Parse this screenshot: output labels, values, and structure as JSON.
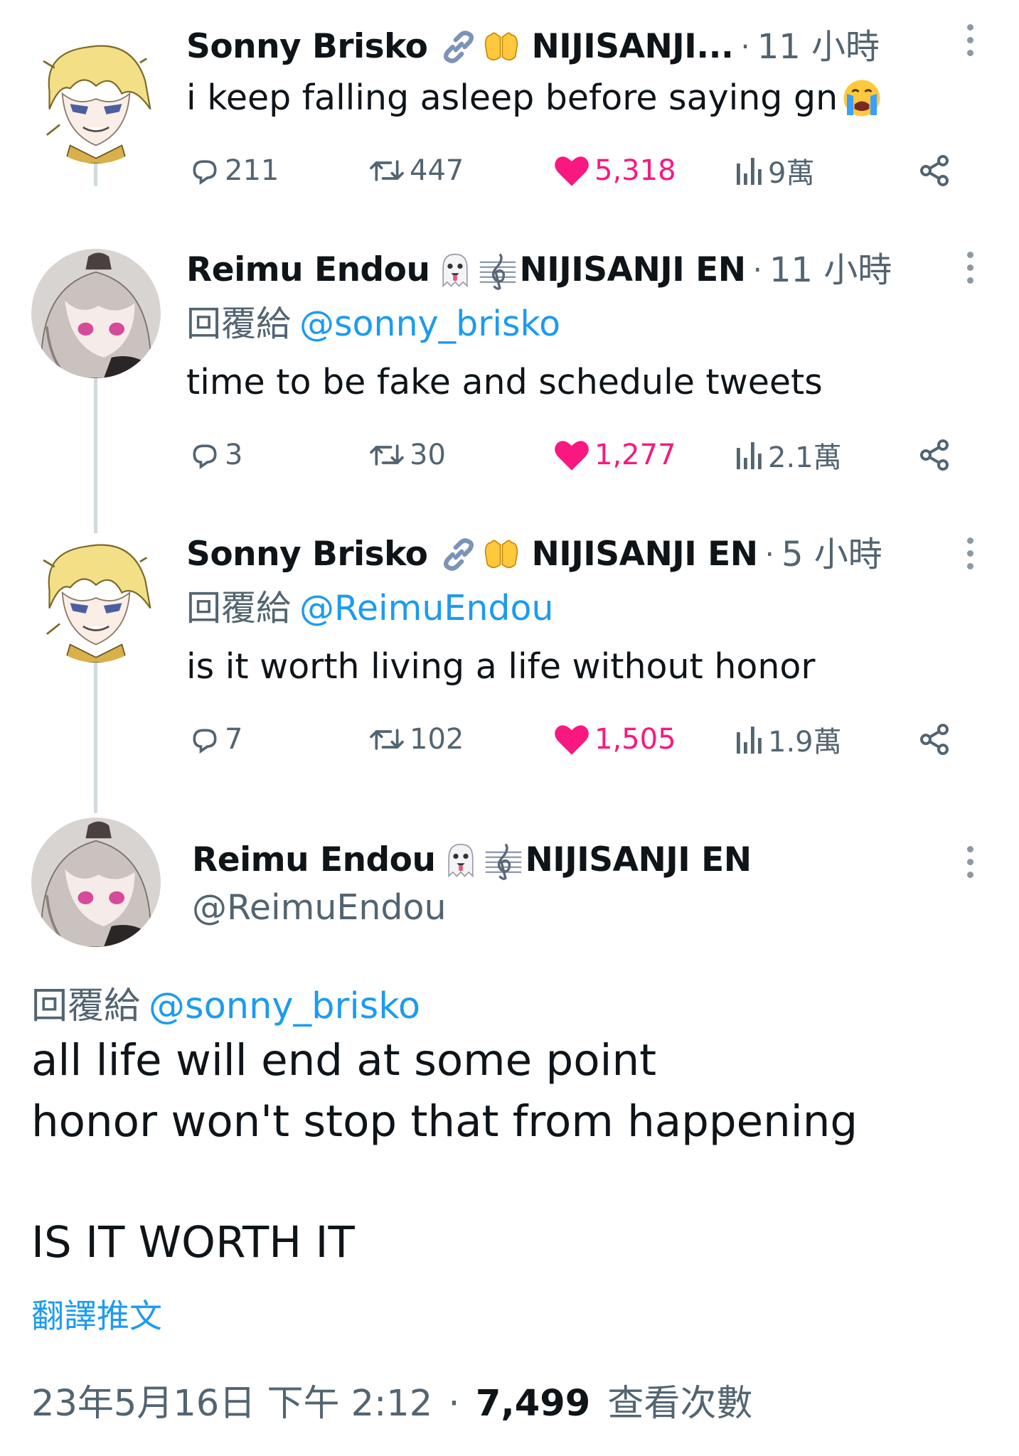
{
  "thread": [
    {
      "author": "Sonny Brisko",
      "badge": "NIJISANJI...",
      "separator": "·",
      "time": "11 小時",
      "reply_label": "",
      "reply_to": "",
      "text": "i keep falling asleep before saying gn",
      "stats": {
        "replies": "211",
        "reposts": "447",
        "likes": "5,318",
        "views": "9萬"
      }
    },
    {
      "author": "Reimu Endou",
      "badge": "NIJISANJI EN",
      "separator": "·",
      "time": "11 小時",
      "reply_label": "回覆給",
      "reply_to": "@sonny_brisko",
      "text": "time to be fake and schedule tweets",
      "stats": {
        "replies": "3",
        "reposts": "30",
        "likes": "1,277",
        "views": "2.1萬"
      }
    },
    {
      "author": "Sonny Brisko",
      "badge": "NIJISANJI EN",
      "separator": "·",
      "time": "5 小時",
      "reply_label": "回覆給",
      "reply_to": "@ReimuEndou",
      "text": "is it worth living a life without honor",
      "stats": {
        "replies": "7",
        "reposts": "102",
        "likes": "1,505",
        "views": "1.9萬"
      }
    }
  ],
  "main": {
    "author": "Reimu Endou",
    "badge": "NIJISANJI EN",
    "handle": "@ReimuEndou",
    "reply_label": "回覆給",
    "reply_to": "@sonny_brisko",
    "lines": [
      "all life will end at some point",
      "honor won't stop  that from happening",
      "IS IT WORTH IT"
    ],
    "translate": "翻譯推文",
    "date": "23年5月16日 下午 2:12",
    "separator": "·",
    "views_count": "7,499",
    "views_label": "查看次數"
  },
  "icons": {
    "reply": "reply-icon",
    "repost": "repost-icon",
    "like": "heart-icon",
    "views": "views-icon",
    "share": "share-icon",
    "more": "more-icon",
    "link": "link-icon",
    "hands": "hands-emoji",
    "ghost": "ghost-emoji",
    "clef": "treble-clef-emoji",
    "crying": "crying-emoji"
  },
  "colors": {
    "accent": "#1d9bf0",
    "like": "#f91880",
    "secondary_text": "#536471",
    "thread_line": "#cfd9de"
  }
}
